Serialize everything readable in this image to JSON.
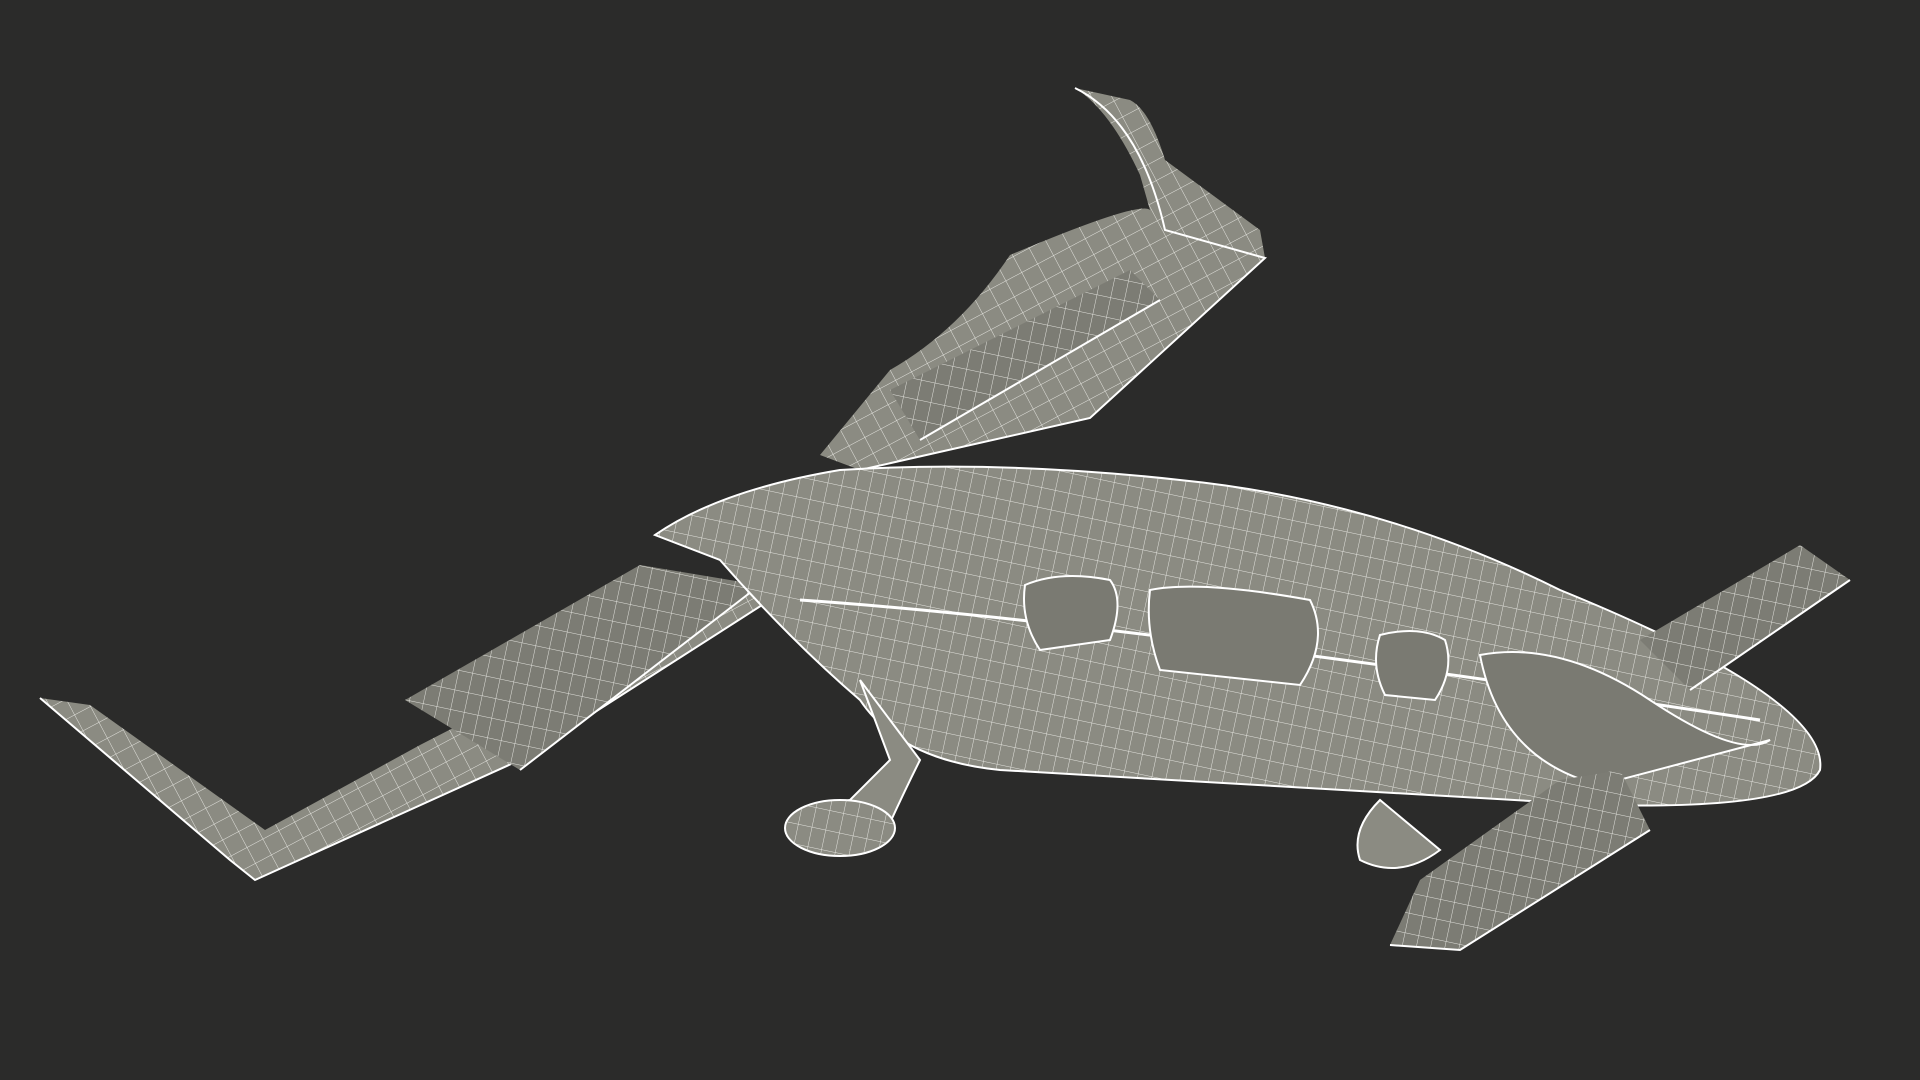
{
  "scene": {
    "background_color": "#2b2b2a",
    "surface_color": "#8b8b82",
    "surface_dark_color": "#6f6f68",
    "wire_color": "#ffffff",
    "subject_icon": "evtol-aircraft-wireframe-icon"
  }
}
